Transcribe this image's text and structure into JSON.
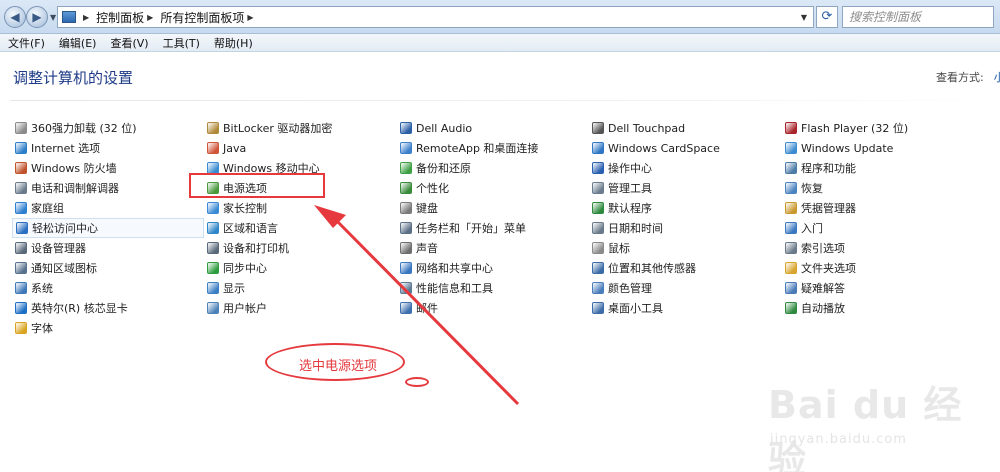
{
  "address": {
    "crumbs": [
      "控制面板",
      "所有控制面板项"
    ],
    "search_placeholder": "搜索控制面板"
  },
  "menu": [
    "文件(F)",
    "编辑(E)",
    "查看(V)",
    "工具(T)",
    "帮助(H)"
  ],
  "page": {
    "title": "调整计算机的设置",
    "view_by_label": "查看方式:",
    "view_by_value": "小图"
  },
  "columns": [
    [
      {
        "label": "360强力卸载 (32 位)",
        "icon": "uninstall-icon",
        "color": "#8a8a8a"
      },
      {
        "label": "Internet 选项",
        "icon": "internet-options-icon",
        "color": "#2d7fc9"
      },
      {
        "label": "Windows 防火墙",
        "icon": "firewall-icon",
        "color": "#c0532c"
      },
      {
        "label": "电话和调制解调器",
        "icon": "phone-modem-icon",
        "color": "#6a7b8c"
      },
      {
        "label": "家庭组",
        "icon": "homegroup-icon",
        "color": "#2f7fd0"
      },
      {
        "label": "轻松访问中心",
        "icon": "ease-of-access-icon",
        "color": "#2a6fc2"
      },
      {
        "label": "设备管理器",
        "icon": "device-manager-icon",
        "color": "#5b6a7a"
      },
      {
        "label": "通知区域图标",
        "icon": "notification-icon",
        "color": "#58718d"
      },
      {
        "label": "系统",
        "icon": "system-icon",
        "color": "#3f79b9"
      },
      {
        "label": "英特尔(R) 核芯显卡",
        "icon": "intel-graphics-icon",
        "color": "#1d6fc5"
      },
      {
        "label": "字体",
        "icon": "fonts-icon",
        "color": "#d9a520"
      }
    ],
    [
      {
        "label": "BitLocker 驱动器加密",
        "icon": "bitlocker-icon",
        "color": "#b08a3a"
      },
      {
        "label": "Java",
        "icon": "java-icon",
        "color": "#d0553a"
      },
      {
        "label": "Windows 移动中心",
        "icon": "mobility-center-icon",
        "color": "#3a8bd0"
      },
      {
        "label": "电源选项",
        "icon": "power-options-icon",
        "color": "#4a9a3d"
      },
      {
        "label": "家长控制",
        "icon": "parental-controls-icon",
        "color": "#3b8ad4"
      },
      {
        "label": "区域和语言",
        "icon": "region-language-icon",
        "color": "#2f86c8"
      },
      {
        "label": "设备和打印机",
        "icon": "devices-printers-icon",
        "color": "#5a6a7a"
      },
      {
        "label": "同步中心",
        "icon": "sync-center-icon",
        "color": "#2f9d3f"
      },
      {
        "label": "显示",
        "icon": "display-icon",
        "color": "#3d7fc4"
      },
      {
        "label": "用户帐户",
        "icon": "user-accounts-icon",
        "color": "#4c82b8"
      }
    ],
    [
      {
        "label": "Dell Audio",
        "icon": "dell-audio-icon",
        "color": "#2b5fa6"
      },
      {
        "label": "RemoteApp 和桌面连接",
        "icon": "remoteapp-icon",
        "color": "#3c7fca"
      },
      {
        "label": "备份和还原",
        "icon": "backup-restore-icon",
        "color": "#3f9f45"
      },
      {
        "label": "个性化",
        "icon": "personalization-icon",
        "color": "#3a8a3c"
      },
      {
        "label": "键盘",
        "icon": "keyboard-icon",
        "color": "#7a7a7a"
      },
      {
        "label": "任务栏和「开始」菜单",
        "icon": "taskbar-icon",
        "color": "#5b6f85"
      },
      {
        "label": "声音",
        "icon": "sound-icon",
        "color": "#6e6e6e"
      },
      {
        "label": "网络和共享中心",
        "icon": "network-sharing-icon",
        "color": "#3a77c0"
      },
      {
        "label": "性能信息和工具",
        "icon": "performance-icon",
        "color": "#5a7a95"
      },
      {
        "label": "邮件",
        "icon": "mail-icon",
        "color": "#3d6fae"
      }
    ],
    [
      {
        "label": "Dell Touchpad",
        "icon": "touchpad-icon",
        "color": "#555"
      },
      {
        "label": "Windows CardSpace",
        "icon": "cardspace-icon",
        "color": "#2f77c5"
      },
      {
        "label": "操作中心",
        "icon": "action-center-icon",
        "color": "#2a5fb0"
      },
      {
        "label": "管理工具",
        "icon": "admin-tools-icon",
        "color": "#6a7c8e"
      },
      {
        "label": "默认程序",
        "icon": "default-programs-icon",
        "color": "#2e8a3d"
      },
      {
        "label": "日期和时间",
        "icon": "date-time-icon",
        "color": "#6a7a8a"
      },
      {
        "label": "鼠标",
        "icon": "mouse-icon",
        "color": "#8a8a8a"
      },
      {
        "label": "位置和其他传感器",
        "icon": "location-sensors-icon",
        "color": "#3b6ca6"
      },
      {
        "label": "颜色管理",
        "icon": "color-management-icon",
        "color": "#4a7dbb"
      },
      {
        "label": "桌面小工具",
        "icon": "gadgets-icon",
        "color": "#3d6ca8"
      }
    ],
    [
      {
        "label": "Flash Player (32 位)",
        "icon": "flash-player-icon",
        "color": "#a8262b"
      },
      {
        "label": "Windows Update",
        "icon": "windows-update-icon",
        "color": "#3d8bd0"
      },
      {
        "label": "程序和功能",
        "icon": "programs-features-icon",
        "color": "#4d7ba6"
      },
      {
        "label": "恢复",
        "icon": "recovery-icon",
        "color": "#4a83c0"
      },
      {
        "label": "凭据管理器",
        "icon": "credential-manager-icon",
        "color": "#c9992f"
      },
      {
        "label": "入门",
        "icon": "getting-started-icon",
        "color": "#3a78c0"
      },
      {
        "label": "索引选项",
        "icon": "indexing-options-icon",
        "color": "#6a7a8a"
      },
      {
        "label": "文件夹选项",
        "icon": "folder-options-icon",
        "color": "#d7a52c"
      },
      {
        "label": "疑难解答",
        "icon": "troubleshooting-icon",
        "color": "#4a7bb8"
      },
      {
        "label": "自动播放",
        "icon": "autoplay-icon",
        "color": "#2f8a40"
      }
    ]
  ],
  "annotation": {
    "callout_text": "选中电源选项"
  },
  "watermark": {
    "main": "Bai du 经验",
    "sub": "jingyan.baidu.com"
  },
  "colors": {
    "annotation_red": "#e5393e",
    "title_blue": "#1e3c87",
    "link_blue": "#1a5aa8"
  }
}
